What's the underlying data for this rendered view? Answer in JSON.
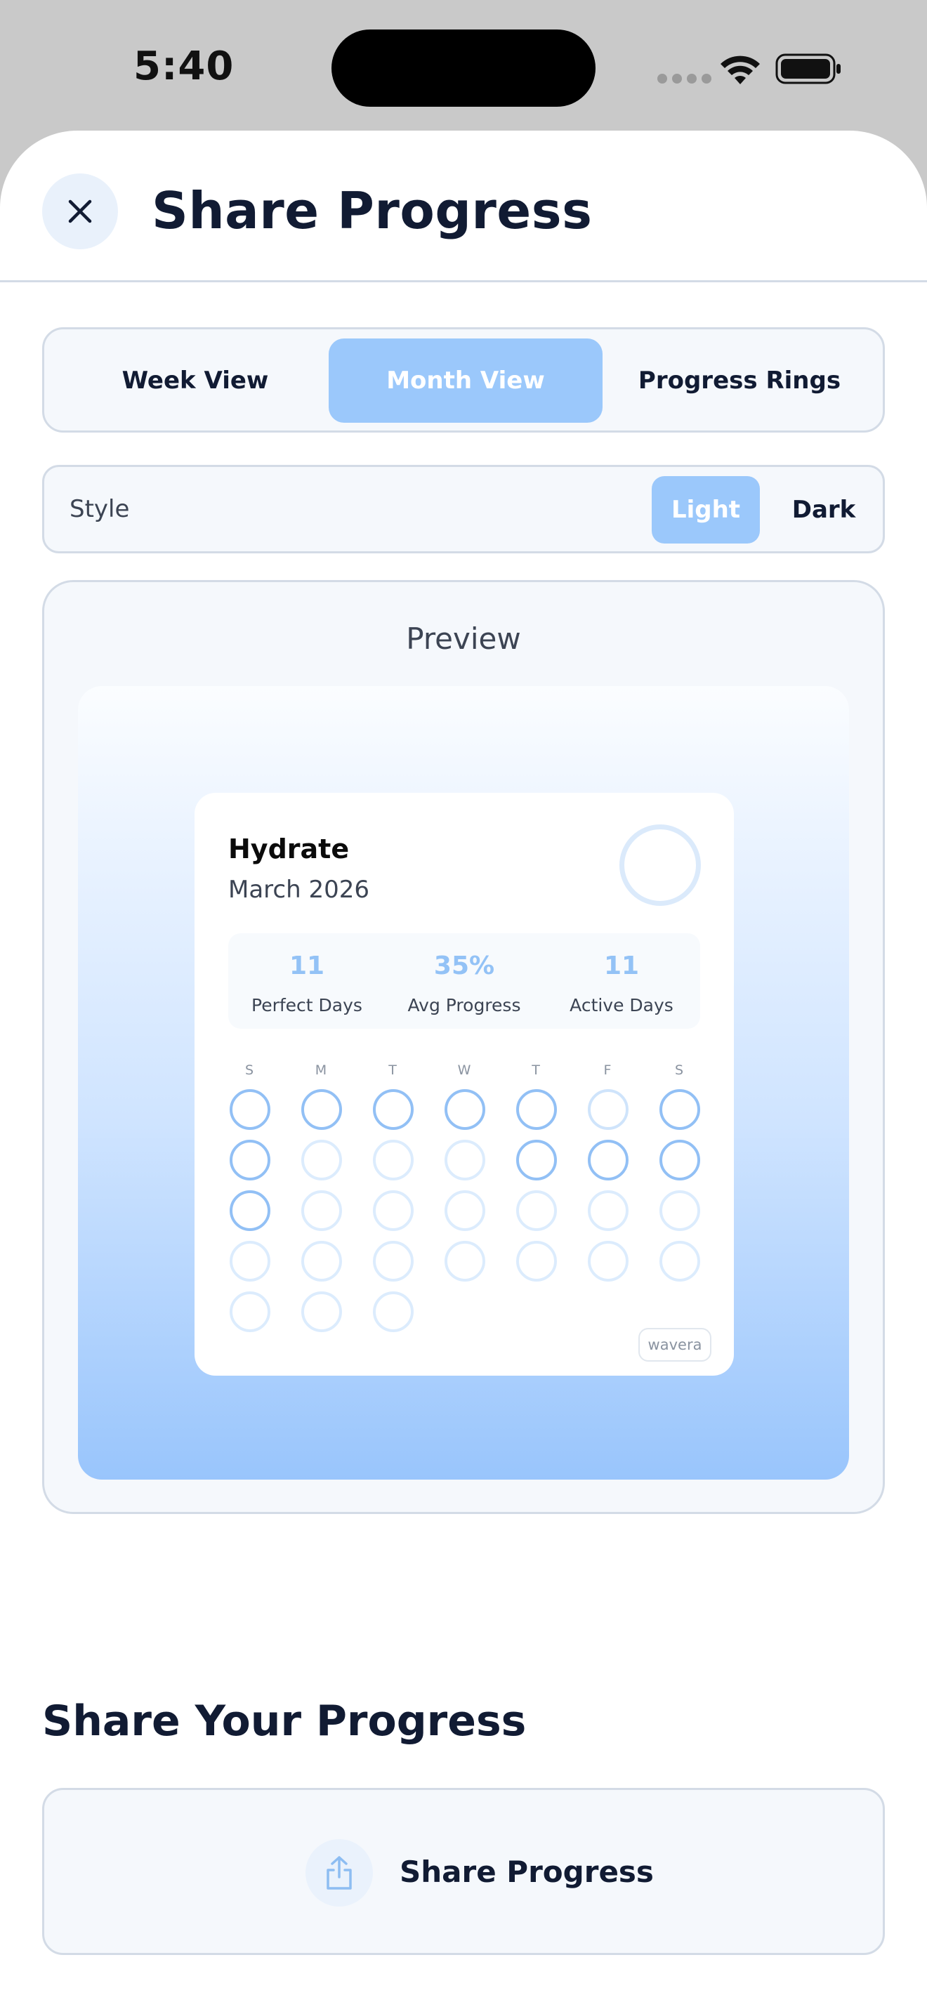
{
  "status_bar": {
    "time": "5:40"
  },
  "header": {
    "title": "Share Progress",
    "close_icon": "close-icon"
  },
  "view_tabs": [
    {
      "label": "Week View",
      "active": false
    },
    {
      "label": "Month View",
      "active": true
    },
    {
      "label": "Progress Rings",
      "active": false
    }
  ],
  "style": {
    "label": "Style",
    "light": "Light",
    "dark": "Dark",
    "selected": "Light"
  },
  "preview": {
    "label": "Preview",
    "card": {
      "title": "Hydrate",
      "subtitle": "March 2026",
      "stats": [
        {
          "value": "11",
          "label": "Perfect Days"
        },
        {
          "value": "35%",
          "label": "Avg Progress"
        },
        {
          "value": "11",
          "label": "Active Days"
        }
      ],
      "weekdays": [
        "S",
        "M",
        "T",
        "W",
        "T",
        "F",
        "S"
      ],
      "days_completed": [
        1,
        1,
        1,
        1,
        1,
        0.3,
        1,
        1,
        0,
        0,
        0,
        1,
        1,
        1,
        1,
        0,
        0,
        0,
        0,
        0,
        0,
        0,
        0,
        0,
        0,
        0,
        0,
        0,
        0,
        0,
        0
      ],
      "watermark": "wavera"
    }
  },
  "share_section": {
    "heading": "Share Your Progress",
    "button_label": "Share Progress",
    "button_icon": "share-icon"
  },
  "colors": {
    "accent": "#9bc8fb",
    "ring_full": "#92c0f5",
    "ring_empty": "#dcecfd",
    "text_dark": "#111b33"
  }
}
